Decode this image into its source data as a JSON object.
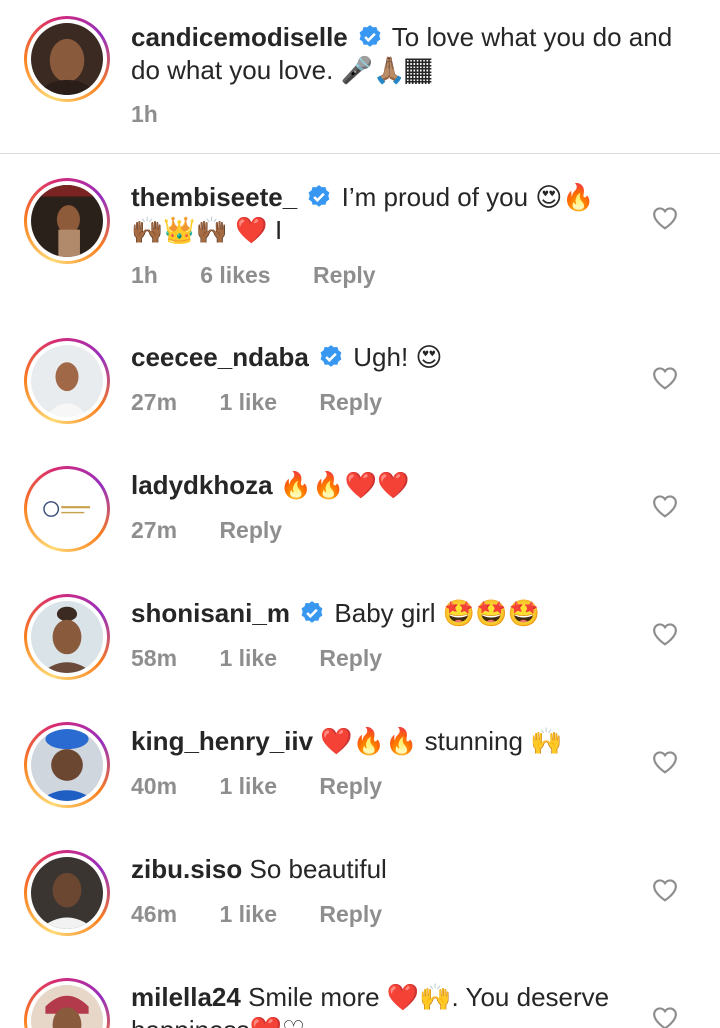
{
  "caption": {
    "username": "candicemodiselle",
    "text": "To love what you do and do what you love. 🎤🙏🏽🏾",
    "time": "1h"
  },
  "comments": [
    {
      "username": "thembiseete_",
      "verified": true,
      "text": "I’m proud of you 😍🔥 🙌🏾👑🙌🏾 ❤️ I",
      "time": "1h",
      "likes": "6 likes",
      "reply": "Reply"
    },
    {
      "username": "ceecee_ndaba",
      "verified": true,
      "text": "Ugh! 😍",
      "time": "27m",
      "likes": "1 like",
      "reply": "Reply"
    },
    {
      "username": "ladydkhoza",
      "verified": false,
      "text": "🔥🔥❤️❤️",
      "time": "27m",
      "likes": "",
      "reply": "Reply"
    },
    {
      "username": "shonisani_m",
      "verified": true,
      "text": "Baby girl 🤩🤩🤩",
      "time": "58m",
      "likes": "1 like",
      "reply": "Reply"
    },
    {
      "username": "king_henry_iiv",
      "verified": false,
      "text": "❤️🔥🔥 stunning 🙌",
      "time": "40m",
      "likes": "1 like",
      "reply": "Reply"
    },
    {
      "username": "zibu.siso",
      "verified": false,
      "text": "So beautiful",
      "time": "46m",
      "likes": "1 like",
      "reply": "Reply"
    },
    {
      "username": "milella24",
      "verified": false,
      "text": "Smile more ❤️🙌. You deserve happiness❤️♡",
      "time": "",
      "likes": "",
      "reply": ""
    }
  ]
}
